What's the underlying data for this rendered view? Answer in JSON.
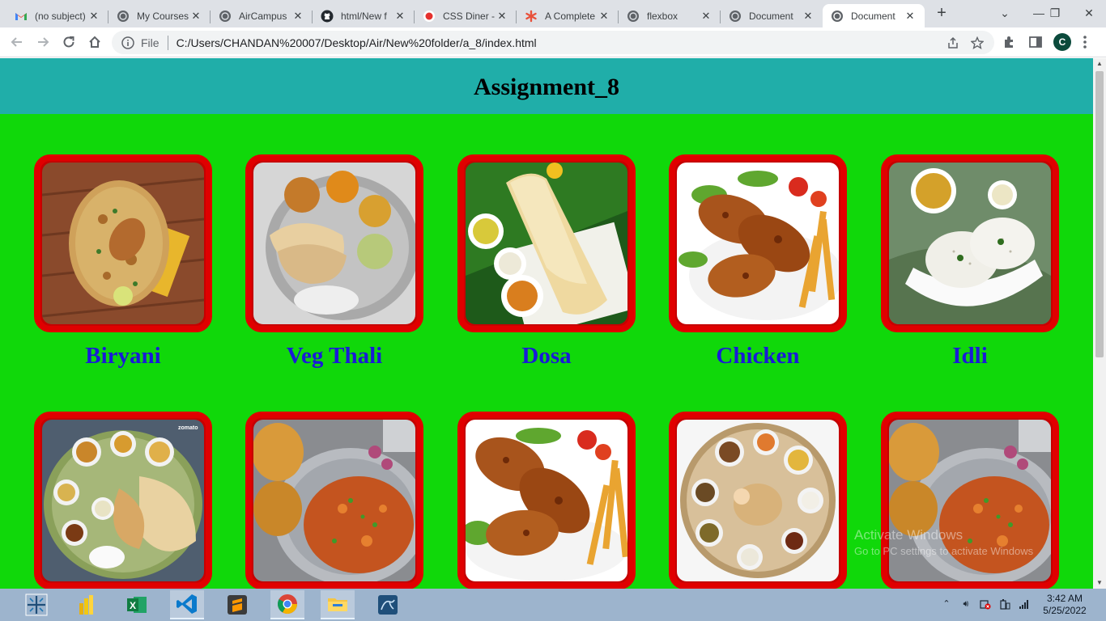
{
  "browser": {
    "tabs": [
      {
        "title": "(no subject)",
        "icon": "gmail-icon",
        "active": false
      },
      {
        "title": "My Courses",
        "icon": "globe-icon",
        "active": false
      },
      {
        "title": "AirCampus",
        "icon": "globe-icon",
        "active": false
      },
      {
        "title": "html/New f",
        "icon": "github-icon",
        "active": false
      },
      {
        "title": "CSS Diner -",
        "icon": "css-diner-icon",
        "active": false
      },
      {
        "title": "A Complete",
        "icon": "csstricks-icon",
        "active": false
      },
      {
        "title": "flexbox",
        "icon": "globe-icon",
        "active": false
      },
      {
        "title": "Document",
        "icon": "globe-icon",
        "active": false
      },
      {
        "title": "Document",
        "icon": "globe-icon",
        "active": true
      }
    ],
    "address": {
      "scheme_label": "File",
      "url": "C:/Users/CHANDAN%20007/Desktop/Air/New%20folder/a_8/index.html"
    },
    "profile_initial": "C"
  },
  "page": {
    "title": "Assignment_8",
    "cards": [
      {
        "label": "Biryani",
        "image": "biryani"
      },
      {
        "label": "Veg Thali",
        "image": "veg-thali"
      },
      {
        "label": "Dosa",
        "image": "dosa"
      },
      {
        "label": "Chicken",
        "image": "chicken"
      },
      {
        "label": "Idli",
        "image": "idli"
      },
      {
        "label": "",
        "image": "thali-platter"
      },
      {
        "label": "",
        "image": "pav-bhaji"
      },
      {
        "label": "",
        "image": "chicken-legs"
      },
      {
        "label": "",
        "image": "north-indian-thali"
      },
      {
        "label": "",
        "image": "pav-bhaji"
      }
    ],
    "watermark": {
      "title": "Activate Windows",
      "subtitle": "Go to PC settings to activate Windows"
    },
    "colors": {
      "header_bg": "#20aea9",
      "page_bg": "#10d80a",
      "card_border": "#e00000",
      "label_color": "#1a1ad8"
    }
  },
  "taskbar": {
    "apps": [
      "tableau-icon",
      "powerbi-icon",
      "excel-icon",
      "vscode-icon",
      "sublime-icon",
      "chrome-icon",
      "file-explorer-icon",
      "mysql-workbench-icon"
    ],
    "time": "3:42 AM",
    "date": "5/25/2022"
  }
}
